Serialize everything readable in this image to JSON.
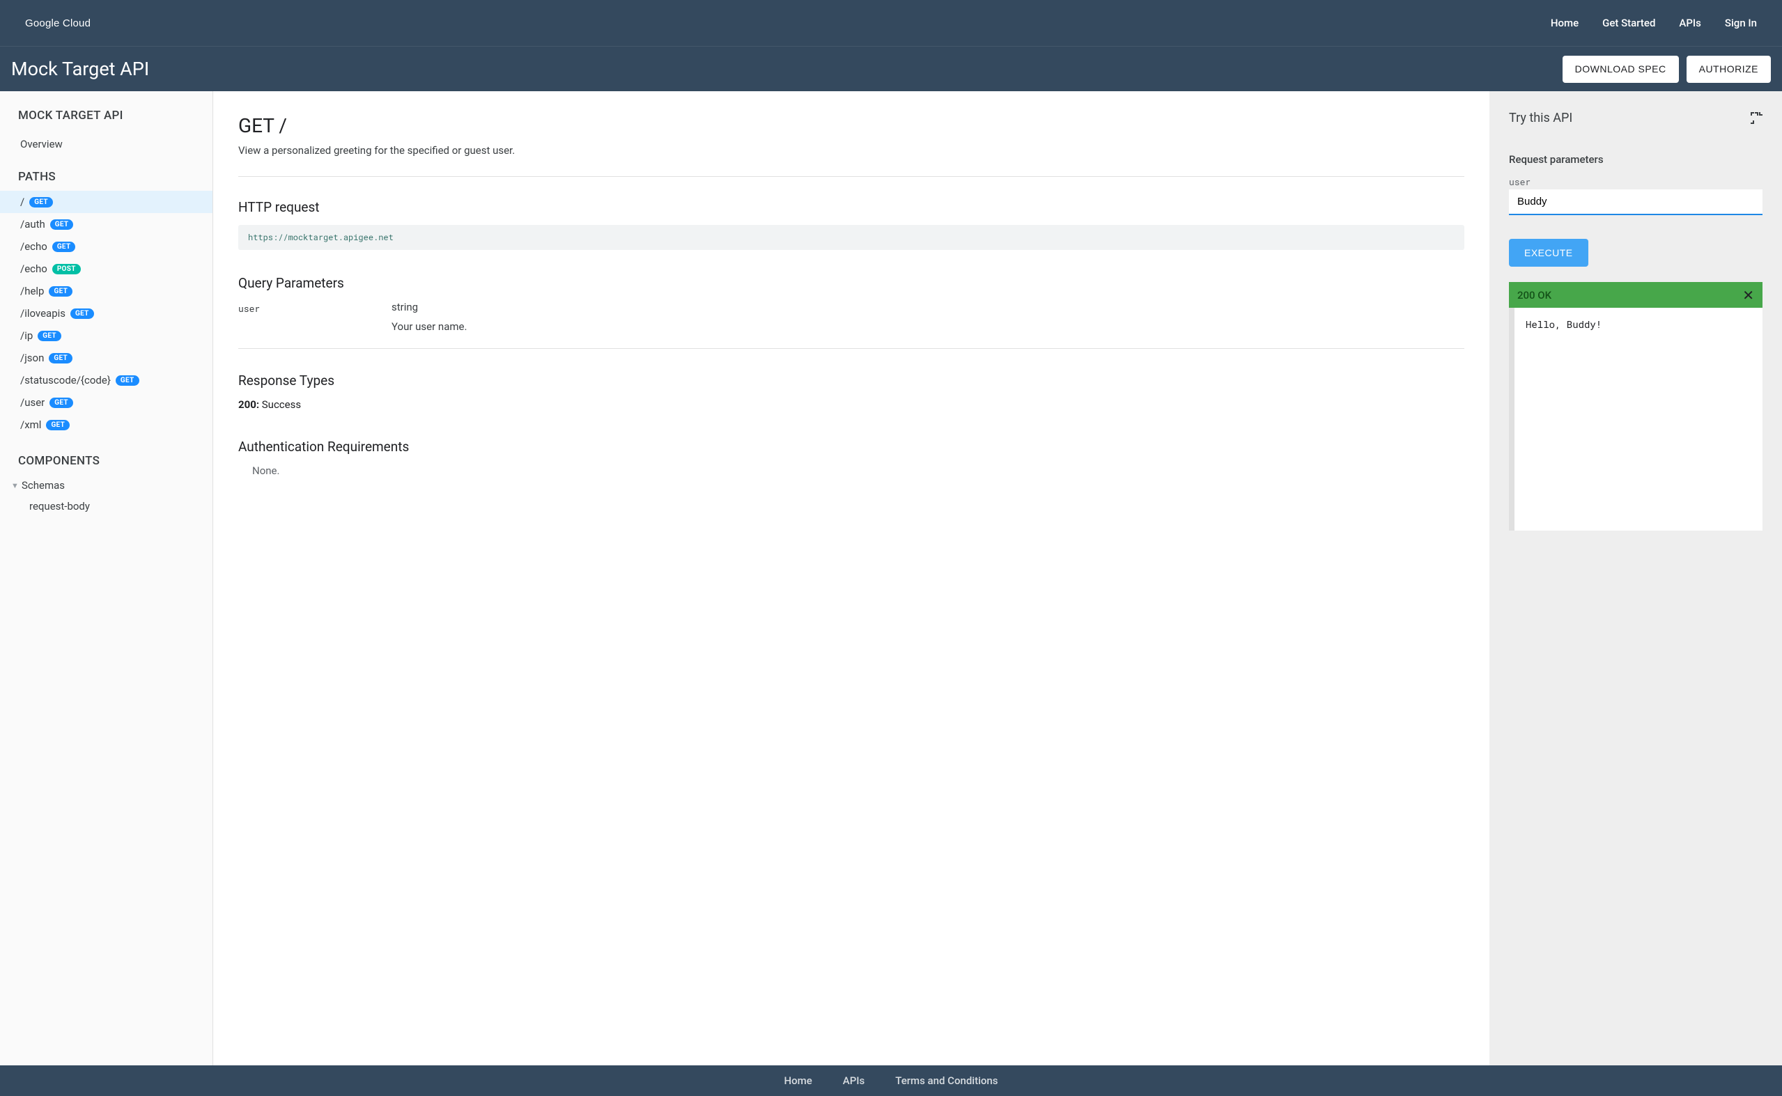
{
  "header": {
    "logo_text": "Google Cloud",
    "nav": [
      "Home",
      "Get Started",
      "APIs",
      "Sign In"
    ]
  },
  "subheader": {
    "title": "Mock Target API",
    "download": "DOWNLOAD SPEC",
    "authorize": "AUTHORIZE"
  },
  "sidebar": {
    "api_title": "MOCK TARGET API",
    "overview": "Overview",
    "paths_title": "PATHS",
    "paths": [
      {
        "path": "/",
        "method": "GET",
        "active": true
      },
      {
        "path": "/auth",
        "method": "GET",
        "active": false
      },
      {
        "path": "/echo",
        "method": "GET",
        "active": false
      },
      {
        "path": "/echo",
        "method": "POST",
        "active": false
      },
      {
        "path": "/help",
        "method": "GET",
        "active": false
      },
      {
        "path": "/iloveapis",
        "method": "GET",
        "active": false
      },
      {
        "path": "/ip",
        "method": "GET",
        "active": false
      },
      {
        "path": "/json",
        "method": "GET",
        "active": false
      },
      {
        "path": "/statuscode/{code}",
        "method": "GET",
        "active": false
      },
      {
        "path": "/user",
        "method": "GET",
        "active": false
      },
      {
        "path": "/xml",
        "method": "GET",
        "active": false
      }
    ],
    "components_title": "COMPONENTS",
    "schemas_label": "Schemas",
    "schema_items": [
      "request-body"
    ]
  },
  "main": {
    "title": "GET /",
    "description": "View a personalized greeting for the specified or guest user.",
    "http_request_h": "HTTP request",
    "http_url": "https://mocktarget.apigee.net",
    "query_h": "Query Parameters",
    "qp": {
      "name": "user",
      "type": "string",
      "desc": "Your user name."
    },
    "resp_h": "Response Types",
    "resp_code": "200:",
    "resp_text": " Success",
    "auth_h": "Authentication Requirements",
    "auth_body": "None."
  },
  "try": {
    "title": "Try this API",
    "req_h": "Request parameters",
    "field_label": "user",
    "field_value": "Buddy",
    "execute": "EXECUTE",
    "status": "200 OK",
    "response_body": "Hello, Buddy!"
  },
  "footer": {
    "links": [
      "Home",
      "APIs",
      "Terms and Conditions"
    ]
  }
}
